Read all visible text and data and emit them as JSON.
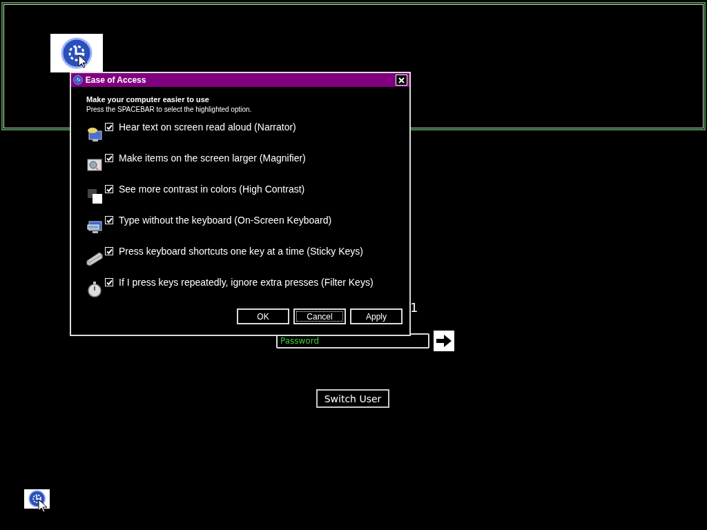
{
  "dialog": {
    "title": "Ease of Access",
    "heading": "Make your computer easier to use",
    "instruction": "Press the SPACEBAR to select the highlighted option.",
    "options": [
      {
        "kind": "narrator",
        "label": "Hear text on screen read aloud (Narrator)",
        "checked": true
      },
      {
        "kind": "magnifier",
        "label": "Make items on the screen larger (Magnifier)",
        "checked": true
      },
      {
        "kind": "contrast",
        "label": "See more contrast in colors (High Contrast)",
        "checked": true
      },
      {
        "kind": "keyboard",
        "label": "Type without the keyboard (On-Screen Keyboard)",
        "checked": true
      },
      {
        "kind": "sticky",
        "label": "Press keyboard shortcuts one key at a time (Sticky Keys)",
        "checked": true
      },
      {
        "kind": "filter",
        "label": "If I press keys repeatedly, ignore extra presses (Filter Keys)",
        "checked": true
      }
    ],
    "buttons": [
      {
        "label": "OK",
        "focused": false
      },
      {
        "label": "Cancel",
        "focused": true
      },
      {
        "label": "Apply",
        "focused": false
      }
    ]
  },
  "login": {
    "user_name_fragment": "1",
    "password": {
      "placeholder": "Password"
    },
    "switch_user": "Switch User"
  }
}
